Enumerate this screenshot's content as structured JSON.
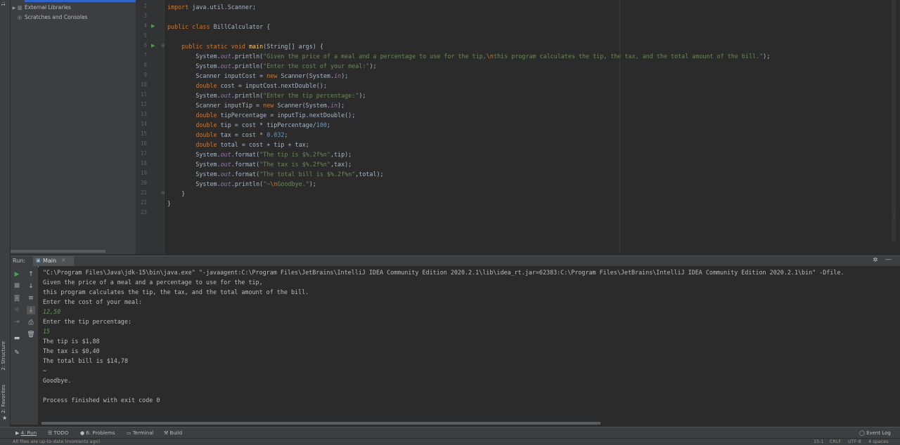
{
  "left_strip": {
    "tab_project": "1:",
    "tab_structure": "2: Structure",
    "tab_favorites": "2: Favorites"
  },
  "project_tree": {
    "external_libraries": "External Libraries",
    "scratches": "Scratches and Consoles"
  },
  "editor": {
    "line_numbers": [
      "2",
      "3",
      "4",
      "5",
      "6",
      "7",
      "8",
      "9",
      "10",
      "11",
      "12",
      "13",
      "14",
      "15",
      "16",
      "17",
      "18",
      "19",
      "20",
      "21",
      "22",
      "23"
    ],
    "lines": [
      [
        {
          "t": "import ",
          "c": "kw"
        },
        {
          "t": "java.util.Scanner;",
          "c": ""
        }
      ],
      [],
      [
        {
          "t": "public class ",
          "c": "kw"
        },
        {
          "t": "BillCalculator {",
          "c": ""
        }
      ],
      [],
      [
        {
          "t": "    public static void ",
          "c": "kw"
        },
        {
          "t": "main",
          "c": "fn"
        },
        {
          "t": "(String[] args) {",
          "c": ""
        }
      ],
      [
        {
          "t": "        System.",
          "c": ""
        },
        {
          "t": "out",
          "c": "it"
        },
        {
          "t": ".println(",
          "c": ""
        },
        {
          "t": "\"Given the price of a meal and a percentage to use for the tip,",
          "c": "str"
        },
        {
          "t": "\\n",
          "c": "esc"
        },
        {
          "t": "this program calculates the tip, the tax, and the total amount of the bill.\"",
          "c": "str"
        },
        {
          "t": ");",
          "c": ""
        }
      ],
      [
        {
          "t": "        System.",
          "c": ""
        },
        {
          "t": "out",
          "c": "it"
        },
        {
          "t": ".println(",
          "c": ""
        },
        {
          "t": "\"Enter the cost of your meal:\"",
          "c": "str"
        },
        {
          "t": ");",
          "c": ""
        }
      ],
      [
        {
          "t": "        Scanner inputCost = ",
          "c": ""
        },
        {
          "t": "new ",
          "c": "kw"
        },
        {
          "t": "Scanner(System.",
          "c": ""
        },
        {
          "t": "in",
          "c": "it"
        },
        {
          "t": ");",
          "c": ""
        }
      ],
      [
        {
          "t": "        double ",
          "c": "kw"
        },
        {
          "t": "cost = inputCost.nextDouble();",
          "c": ""
        }
      ],
      [
        {
          "t": "        System.",
          "c": ""
        },
        {
          "t": "out",
          "c": "it"
        },
        {
          "t": ".println(",
          "c": ""
        },
        {
          "t": "\"Enter the tip percentage:\"",
          "c": "str"
        },
        {
          "t": ");",
          "c": ""
        }
      ],
      [
        {
          "t": "        Scanner inputTip = ",
          "c": ""
        },
        {
          "t": "new ",
          "c": "kw"
        },
        {
          "t": "Scanner(System.",
          "c": ""
        },
        {
          "t": "in",
          "c": "it"
        },
        {
          "t": ");",
          "c": ""
        }
      ],
      [
        {
          "t": "        double ",
          "c": "kw"
        },
        {
          "t": "tipPercentage = inputTip.nextDouble();",
          "c": ""
        }
      ],
      [
        {
          "t": "        double ",
          "c": "kw"
        },
        {
          "t": "tip = cost * tipPercentage/",
          "c": ""
        },
        {
          "t": "100",
          "c": "num"
        },
        {
          "t": ";",
          "c": ""
        }
      ],
      [
        {
          "t": "        double ",
          "c": "kw"
        },
        {
          "t": "tax = cost * ",
          "c": ""
        },
        {
          "t": "0.032",
          "c": "num"
        },
        {
          "t": ";",
          "c": ""
        }
      ],
      [
        {
          "t": "        double ",
          "c": "kw"
        },
        {
          "t": "total = cost + tip + tax;",
          "c": ""
        }
      ],
      [
        {
          "t": "        System.",
          "c": ""
        },
        {
          "t": "out",
          "c": "it"
        },
        {
          "t": ".format(",
          "c": ""
        },
        {
          "t": "\"The tip is $%.2f%n\"",
          "c": "str"
        },
        {
          "t": ",tip);",
          "c": ""
        }
      ],
      [
        {
          "t": "        System.",
          "c": ""
        },
        {
          "t": "out",
          "c": "it"
        },
        {
          "t": ".format(",
          "c": ""
        },
        {
          "t": "\"The tax is $%.2f%n\"",
          "c": "str"
        },
        {
          "t": ",tax);",
          "c": ""
        }
      ],
      [
        {
          "t": "        System.",
          "c": ""
        },
        {
          "t": "out",
          "c": "it"
        },
        {
          "t": ".format(",
          "c": ""
        },
        {
          "t": "\"The total bill is $%.2f%n\"",
          "c": "str"
        },
        {
          "t": ",total);",
          "c": ""
        }
      ],
      [
        {
          "t": "        System.",
          "c": ""
        },
        {
          "t": "out",
          "c": "it"
        },
        {
          "t": ".println(",
          "c": ""
        },
        {
          "t": "\"~",
          "c": "str"
        },
        {
          "t": "\\n",
          "c": "esc"
        },
        {
          "t": "Goodbye.\"",
          "c": "str"
        },
        {
          "t": ");",
          "c": ""
        }
      ],
      [
        {
          "t": "    }",
          "c": ""
        }
      ],
      [
        {
          "t": "}",
          "c": ""
        }
      ],
      []
    ]
  },
  "run_panel": {
    "label": "Run:",
    "tab": "Main",
    "output": [
      {
        "t": "\"C:\\Program Files\\Java\\jdk-15\\bin\\java.exe\" \"-javaagent:C:\\Program Files\\JetBrains\\IntelliJ IDEA Community Edition 2020.2.1\\lib\\idea_rt.jar=62383:C:\\Program Files\\JetBrains\\IntelliJ IDEA Community Edition 2020.2.1\\bin\" -Dfile.",
        "c": ""
      },
      {
        "t": "Given the price of a meal and a percentage to use for the tip,",
        "c": ""
      },
      {
        "t": "this program calculates the tip, the tax, and the total amount of the bill.",
        "c": ""
      },
      {
        "t": "Enter the cost of your meal:",
        "c": ""
      },
      {
        "t": "12,50",
        "c": "in"
      },
      {
        "t": "Enter the tip percentage:",
        "c": ""
      },
      {
        "t": "15",
        "c": "in"
      },
      {
        "t": "The tip is $1,88",
        "c": ""
      },
      {
        "t": "The tax is $0,40",
        "c": ""
      },
      {
        "t": "The total bill is $14,78",
        "c": ""
      },
      {
        "t": "~",
        "c": ""
      },
      {
        "t": "Goodbye.",
        "c": ""
      },
      {
        "t": "",
        "c": ""
      },
      {
        "t": "Process finished with exit code 0",
        "c": ""
      }
    ]
  },
  "bottom_bar": {
    "run": "4: Run",
    "todo": "TODO",
    "problems": "6: Problems",
    "terminal": "Terminal",
    "build": "Build",
    "event_log": "Event Log"
  },
  "status_bar": {
    "message": "All files are up-to-date (moments ago)",
    "position": "15:1",
    "line_sep": "CRLF",
    "encoding": "UTF-8",
    "indent": "4 spaces"
  }
}
